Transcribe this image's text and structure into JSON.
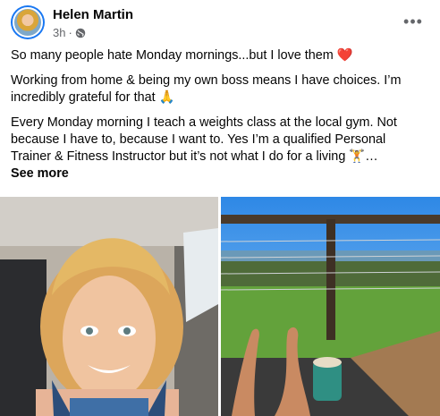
{
  "post": {
    "author": "Helen Martin",
    "time": "3h",
    "paragraphs": [
      "So many people hate Monday mornings...but I love them ❤️",
      "Working from home & being my own boss means I have choices. I’m incredibly grateful for that 🙏",
      "Every Monday morning I teach a weights class at the local gym. Not because I have to, because I want to. Yes I’m a qualified Personal Trainer & Fitness Instructor but it’s not what I do for a living 🏋️…"
    ],
    "see_more": "See more"
  },
  "icons": {
    "more": "more-options-icon",
    "privacy": "globe-icon"
  },
  "colors": {
    "link": "#1877f2",
    "meta": "#65676b"
  }
}
